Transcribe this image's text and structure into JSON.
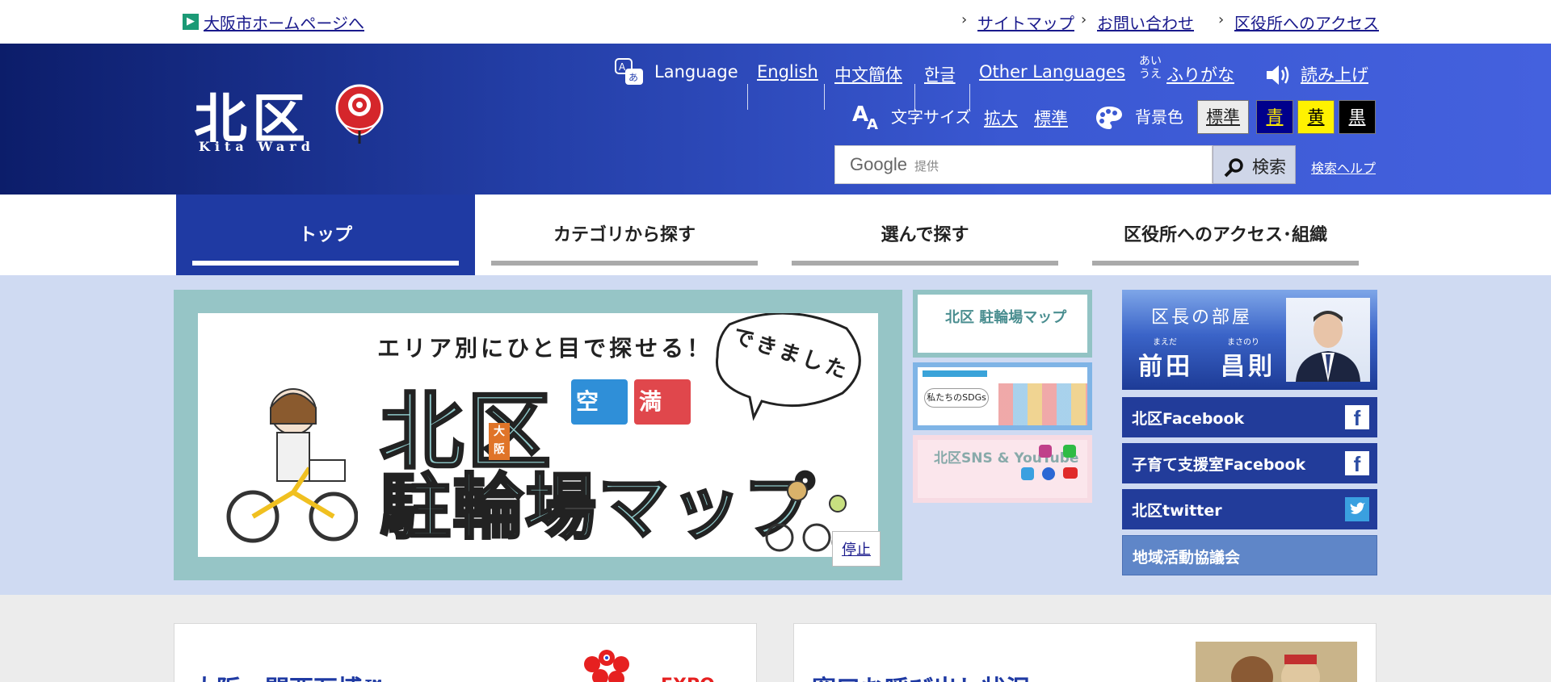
{
  "util": {
    "home_link": "大阪市ホームページへ",
    "sitemap": "サイトマップ",
    "contact": "お問い合わせ",
    "access": "区役所へのアクセス"
  },
  "header": {
    "logo_kanji": "北区",
    "logo_romaji": "Kita Ward",
    "language_label": "Language",
    "lang_english": "English",
    "lang_chinese": "中文簡体",
    "lang_korean": "한글",
    "lang_other": "Other Languages",
    "furigana_icon": "あい\nうえ",
    "furigana": "ふりがな",
    "read_aloud": "読み上げ",
    "font_size_label": "文字サイズ",
    "font_enlarge": "拡大",
    "font_standard": "標準",
    "bg_label": "背景色",
    "bg_options": [
      "標準",
      "青",
      "黄",
      "黒"
    ],
    "search_provider_brand": "Google",
    "search_provider": "提供",
    "search_button": "検索",
    "search_help": "検索ヘルプ"
  },
  "nav": {
    "tabs": [
      "トップ",
      "カテゴリから探す",
      "選んで探す",
      "区役所へのアクセス･組織"
    ]
  },
  "slider": {
    "caption": "エリア別にひと目で探せる！",
    "big_line1": "北区",
    "osaka_tag": "大阪",
    "big_line2": "駐輪場マップ",
    "sign_empty": "空",
    "sign_full": "満",
    "bubble": "できました",
    "pause": "停止"
  },
  "thumbs": [
    {
      "text": "北区 駐輪場マップ"
    },
    {
      "text": "私たちのSDGs"
    },
    {
      "text": "北区SNS & YouTube"
    }
  ],
  "mayor": {
    "room": "区長の部屋",
    "ruby_family": "まえだ",
    "ruby_given": "まさのり",
    "name": "前田　昌則"
  },
  "side_links": [
    {
      "label": "北区Facebook",
      "icon": "facebook-icon"
    },
    {
      "label": "子育て支援室Facebook",
      "icon": "facebook-icon"
    },
    {
      "label": "北区twitter",
      "icon": "twitter-icon"
    },
    {
      "label": "地域活動協議会",
      "icon": ""
    }
  ],
  "cards": {
    "left_title": "大阪・関西万博™",
    "left_logo": "EXPO",
    "right_title": "窓口お呼び出し状況"
  },
  "colors": {
    "header_dark": "#0c1d6a",
    "header_light": "#4461de",
    "nav_active": "#1f3aa3",
    "band": "#cfdaf2",
    "slider_frame": "#96c5c6"
  }
}
